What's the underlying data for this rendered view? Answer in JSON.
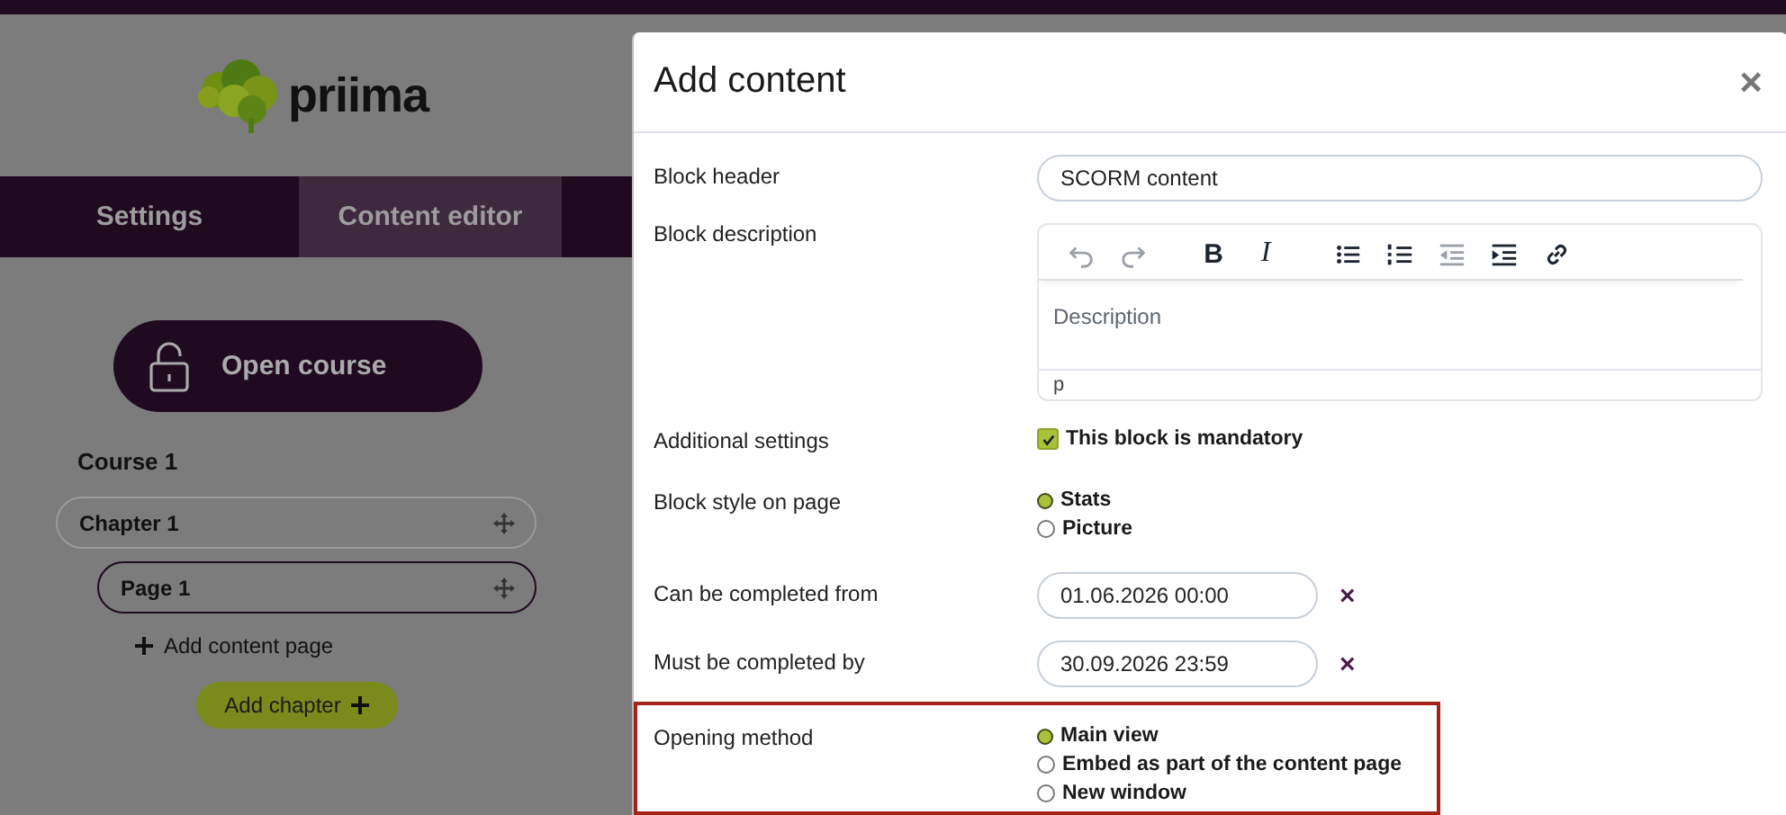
{
  "page": {
    "logo": "priima",
    "tabs": [
      {
        "label": "Settings",
        "selected": false
      },
      {
        "label": "Content editor",
        "selected": true
      }
    ],
    "open_course_button": "Open course",
    "course": {
      "title": "Course 1",
      "chapters": [
        {
          "label": "Chapter 1",
          "children": [
            {
              "label": "Page 1"
            }
          ]
        }
      ]
    },
    "add_content_page": "Add content page",
    "add_chapter_button": "Add chapter"
  },
  "modal": {
    "title": "Add content",
    "close": "×",
    "fields": [
      {
        "kind": "text",
        "label": "Block header",
        "value": "SCORM content"
      },
      {
        "kind": "editor",
        "label": "Block description",
        "placeholder": "Description",
        "path": "p",
        "toolbar": [
          {
            "kind": "undo",
            "disabled": true
          },
          {
            "kind": "redo",
            "disabled": true
          },
          {
            "kind": "bold",
            "label": "B",
            "disabled": false
          },
          {
            "kind": "italic",
            "label": "I",
            "disabled": false
          },
          {
            "kind": "bullets",
            "disabled": false
          },
          {
            "kind": "numbers",
            "disabled": false
          },
          {
            "kind": "outdent",
            "disabled": true
          },
          {
            "kind": "indent",
            "disabled": false
          },
          {
            "kind": "link",
            "disabled": false
          }
        ]
      },
      {
        "kind": "checkbox",
        "label": "Additional settings",
        "option": "This block is mandatory",
        "checked": true
      },
      {
        "kind": "radio",
        "label": "Block style on page",
        "highlighted": false,
        "options": [
          {
            "label": "Stats",
            "selected": true
          },
          {
            "label": "Picture",
            "selected": false
          }
        ]
      },
      {
        "kind": "date",
        "label": "Can be completed from",
        "value": "01.06.2026 00:00",
        "clear": "×"
      },
      {
        "kind": "date",
        "label": "Must be completed by",
        "value": "30.09.2026 23:59",
        "clear": "×"
      },
      {
        "kind": "radio",
        "label": "Opening method",
        "highlighted": true,
        "options": [
          {
            "label": "Main view",
            "selected": true
          },
          {
            "label": "Embed as part of the content page",
            "selected": false
          },
          {
            "label": "New window",
            "selected": false
          }
        ]
      }
    ]
  }
}
